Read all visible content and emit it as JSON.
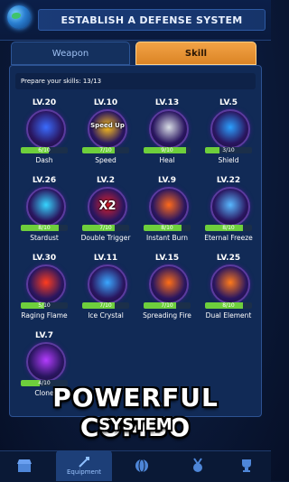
{
  "header": {
    "title": "ESTABLISH A DEFENSE SYSTEM"
  },
  "tabs": [
    {
      "label": "Weapon"
    },
    {
      "label": "Skill"
    }
  ],
  "panel": {
    "prepare_text": "Prepare your skills: 13/13"
  },
  "skills": [
    {
      "level": "LV.20",
      "name": "Dash",
      "progress": "6/10",
      "icon": "dash-icon",
      "color": "#3a6cff"
    },
    {
      "level": "LV.10",
      "name": "Speed",
      "progress": "7/10",
      "icon": "speed-up-icon",
      "overlay": "Speed Up",
      "color": "#ffc21a"
    },
    {
      "level": "LV.13",
      "name": "Heal",
      "progress": "9/10",
      "icon": "first-aid-kit-icon",
      "color": "#d9dee6"
    },
    {
      "level": "LV.5",
      "name": "Shield",
      "progress": "3/10",
      "icon": "hex-shield-icon",
      "color": "#2aa0ff"
    },
    {
      "level": "LV.26",
      "name": "Stardust",
      "progress": "8/10",
      "icon": "star-icon",
      "color": "#35d6ff"
    },
    {
      "level": "LV.2",
      "name": "Double Trigger",
      "progress": "7/10",
      "icon": "x2-icon",
      "overlay": "X2",
      "color": "#e0202a"
    },
    {
      "level": "LV.9",
      "name": "Instant Burn",
      "progress": "8/10",
      "icon": "flame-icon",
      "color": "#ff6a1a"
    },
    {
      "level": "LV.22",
      "name": "Eternal Freeze",
      "progress": "8/10",
      "icon": "ice-crystal-icon",
      "color": "#58b8ff"
    },
    {
      "level": "LV.30",
      "name": "Raging Flame",
      "progress": "5/10",
      "icon": "flaming-skull-icon",
      "color": "#ff3c1e"
    },
    {
      "level": "LV.11",
      "name": "Ice Crystal",
      "progress": "7/10",
      "icon": "ice-shards-icon",
      "color": "#3aa7ff"
    },
    {
      "level": "LV.15",
      "name": "Spreading Fire",
      "progress": "7/10",
      "icon": "fire-spiral-icon",
      "color": "#ff6e16"
    },
    {
      "level": "LV.25",
      "name": "Dual Element",
      "progress": "8/10",
      "icon": "yin-yang-element-icon",
      "color": "#ff7a1a"
    },
    {
      "level": "LV.7",
      "name": "Clone",
      "progress": "4/10",
      "icon": "clone-ships-icon",
      "color": "#b43cff"
    }
  ],
  "banner": {
    "line1": "POWERFUL COMBO",
    "line2": "SYSTEM"
  },
  "nav": {
    "items": [
      {
        "icon": "shop-icon"
      },
      {
        "icon": "equipment-icon",
        "label": "Equipment",
        "active": true
      },
      {
        "icon": "world-icon"
      },
      {
        "icon": "medal-icon"
      },
      {
        "icon": "trophy-icon"
      }
    ]
  }
}
